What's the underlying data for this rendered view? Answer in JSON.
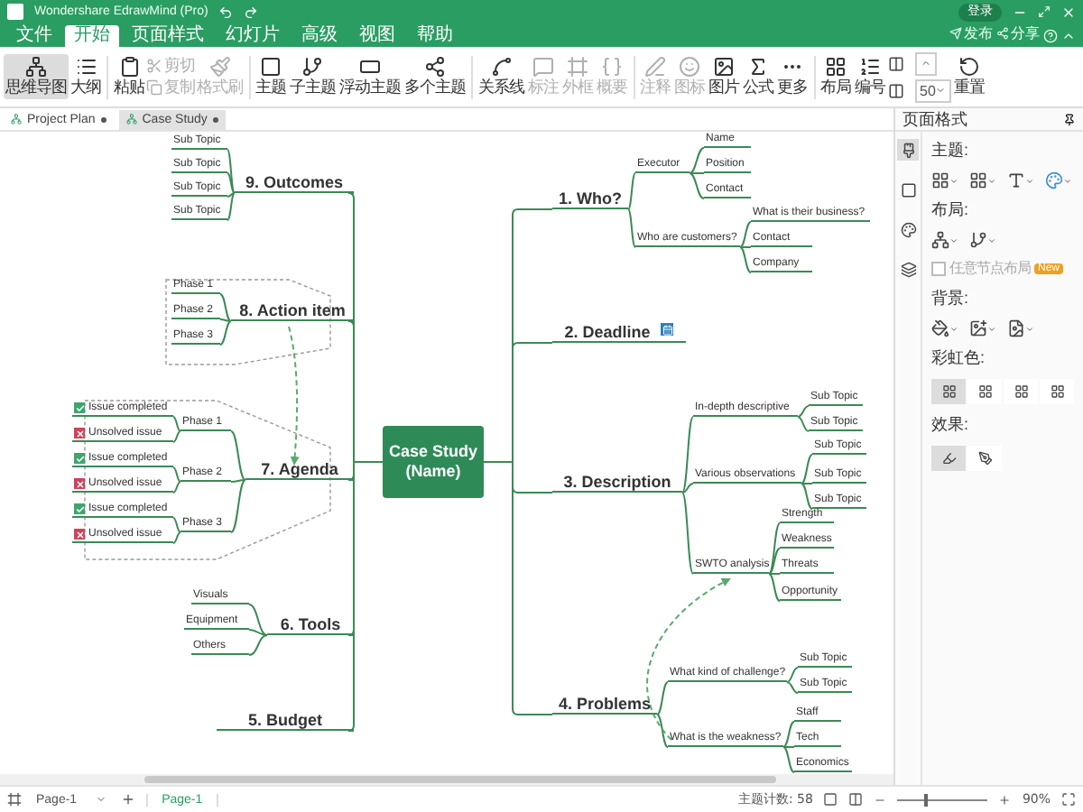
{
  "app": {
    "title": "Wondershare EdrawMind (Pro)",
    "login": "登录",
    "actions": [
      "发布",
      "分享"
    ]
  },
  "menu": [
    {
      "label": "文件",
      "selected": false
    },
    {
      "label": "开始",
      "selected": true
    },
    {
      "label": "页面样式",
      "selected": false
    },
    {
      "label": "幻灯片",
      "selected": false
    },
    {
      "label": "高级",
      "selected": false
    },
    {
      "label": "视图",
      "selected": false
    },
    {
      "label": "帮助",
      "selected": false
    }
  ],
  "ribbon": [
    {
      "kind": "large",
      "label": "思维导图",
      "selected": true,
      "disabled": false
    },
    {
      "kind": "large",
      "label": "大纲",
      "selected": false,
      "disabled": false
    },
    {
      "kind": "large",
      "label": "粘贴",
      "selected": false,
      "disabled": false
    },
    {
      "kind": "small",
      "label": "剪切",
      "selected": false,
      "disabled": true
    },
    {
      "kind": "small",
      "label": "复制",
      "selected": false,
      "disabled": true
    },
    {
      "kind": "large",
      "label": "格式刷",
      "selected": false,
      "disabled": true
    },
    {
      "kind": "large",
      "label": "主题",
      "selected": false,
      "disabled": false
    },
    {
      "kind": "large",
      "label": "子主题",
      "selected": false,
      "disabled": false
    },
    {
      "kind": "large",
      "label": "浮动主题",
      "selected": false,
      "disabled": false
    },
    {
      "kind": "large",
      "label": "多个主题",
      "selected": false,
      "disabled": false
    },
    {
      "kind": "large",
      "label": "关系线",
      "selected": false,
      "disabled": false
    },
    {
      "kind": "large",
      "label": "标注",
      "selected": false,
      "disabled": true
    },
    {
      "kind": "large",
      "label": "外框",
      "selected": false,
      "disabled": true
    },
    {
      "kind": "large",
      "label": "概要",
      "selected": false,
      "disabled": true
    },
    {
      "kind": "large",
      "label": "注释",
      "selected": false,
      "disabled": true
    },
    {
      "kind": "large",
      "label": "图标",
      "selected": false,
      "disabled": true
    },
    {
      "kind": "large",
      "label": "图片",
      "selected": false,
      "disabled": false
    },
    {
      "kind": "large",
      "label": "公式",
      "selected": false,
      "disabled": false
    },
    {
      "kind": "large",
      "label": "更多",
      "selected": false,
      "disabled": false
    },
    {
      "kind": "large",
      "label": "布局",
      "selected": false,
      "disabled": false
    },
    {
      "kind": "large",
      "label": "编号",
      "selected": false,
      "disabled": false
    },
    {
      "kind": "spinner",
      "label": "50",
      "selected": false,
      "disabled": false
    },
    {
      "kind": "large",
      "label": "重置",
      "selected": false,
      "disabled": false
    }
  ],
  "doc_tabs": [
    {
      "label": "Project Plan",
      "selected": false
    },
    {
      "label": "Case Study",
      "selected": true
    }
  ],
  "mindmap": {
    "central": "Case Study (Name)",
    "right": [
      {
        "label": "1.  Who?",
        "children": [
          {
            "label": "Executor",
            "children": [
              {
                "label": "Name"
              },
              {
                "label": "Position"
              },
              {
                "label": "Contact"
              }
            ]
          },
          {
            "label": "Who are customers?",
            "children": [
              {
                "label": "What is their business?"
              },
              {
                "label": "Contact"
              },
              {
                "label": "Company"
              }
            ]
          }
        ]
      },
      {
        "label": "2. Deadline"
      },
      {
        "label": "3. Description",
        "children": [
          {
            "label": "In-depth descriptive",
            "children": [
              {
                "label": "Sub Topic"
              },
              {
                "label": "Sub Topic"
              }
            ]
          },
          {
            "label": "Various observations",
            "children": [
              {
                "label": "Sub Topic"
              },
              {
                "label": "Sub Topic"
              },
              {
                "label": "Sub Topic"
              }
            ]
          },
          {
            "label": "SWTO analysis",
            "children": [
              {
                "label": "Strength"
              },
              {
                "label": "Weakness"
              },
              {
                "label": "Threats"
              },
              {
                "label": "Opportunity"
              }
            ]
          }
        ]
      },
      {
        "label": "4. Problems",
        "children": [
          {
            "label": "What kind of challenge?",
            "children": [
              {
                "label": "Sub Topic"
              },
              {
                "label": "Sub Topic"
              }
            ]
          },
          {
            "label": "What is the weakness?",
            "children": [
              {
                "label": "Staff"
              },
              {
                "label": "Tech"
              },
              {
                "label": "Economics"
              }
            ]
          }
        ]
      }
    ],
    "left": [
      {
        "label": "9. Outcomes",
        "children": [
          {
            "label": "Sub Topic"
          },
          {
            "label": "Sub Topic"
          },
          {
            "label": "Sub Topic"
          },
          {
            "label": "Sub Topic"
          }
        ]
      },
      {
        "label": "8. Action item",
        "children": [
          {
            "label": "Phase 1"
          },
          {
            "label": "Phase 2"
          },
          {
            "label": "Phase 3"
          }
        ]
      },
      {
        "label": "7. Agenda",
        "children": [
          {
            "label": "Phase 1",
            "children": [
              {
                "label": "Issue completed",
                "kind": "done"
              },
              {
                "label": "Unsolved issue",
                "kind": "unsolved"
              }
            ]
          },
          {
            "label": "Phase 2",
            "children": [
              {
                "label": "Issue completed",
                "kind": "done"
              },
              {
                "label": "Unsolved issue",
                "kind": "unsolved"
              }
            ]
          },
          {
            "label": "Phase 3",
            "children": [
              {
                "label": "Issue completed",
                "kind": "done"
              },
              {
                "label": "Unsolved issue",
                "kind": "unsolved"
              }
            ]
          }
        ]
      },
      {
        "label": "6. Tools",
        "children": [
          {
            "label": "Visuals"
          },
          {
            "label": "Equipment"
          },
          {
            "label": "Others"
          }
        ]
      },
      {
        "label": "5. Budget"
      }
    ]
  },
  "side_panel": {
    "title": "页面格式",
    "icon_tabs": [
      {
        "selected": true
      },
      {
        "selected": false
      },
      {
        "selected": false
      },
      {
        "selected": false
      }
    ],
    "theme_label": "主题:",
    "layout_label": "布局:",
    "checkbox": {
      "label": "任意节点布局",
      "checked": false,
      "badge": "New"
    },
    "background_label": "背景:",
    "rainbow_label": "彩虹色:",
    "rainbow": [
      {
        "selected": true
      },
      {
        "selected": false
      },
      {
        "selected": false
      },
      {
        "selected": false
      }
    ],
    "effect_label": "效果:",
    "effects": [
      {
        "selected": true
      },
      {
        "selected": false
      }
    ]
  },
  "status_bar": {
    "page_select": "Page-1",
    "page_tab": "Page-1",
    "topic_count": "主题计数: 58",
    "zoom": {
      "level": 0.3,
      "reading": "90%"
    }
  }
}
